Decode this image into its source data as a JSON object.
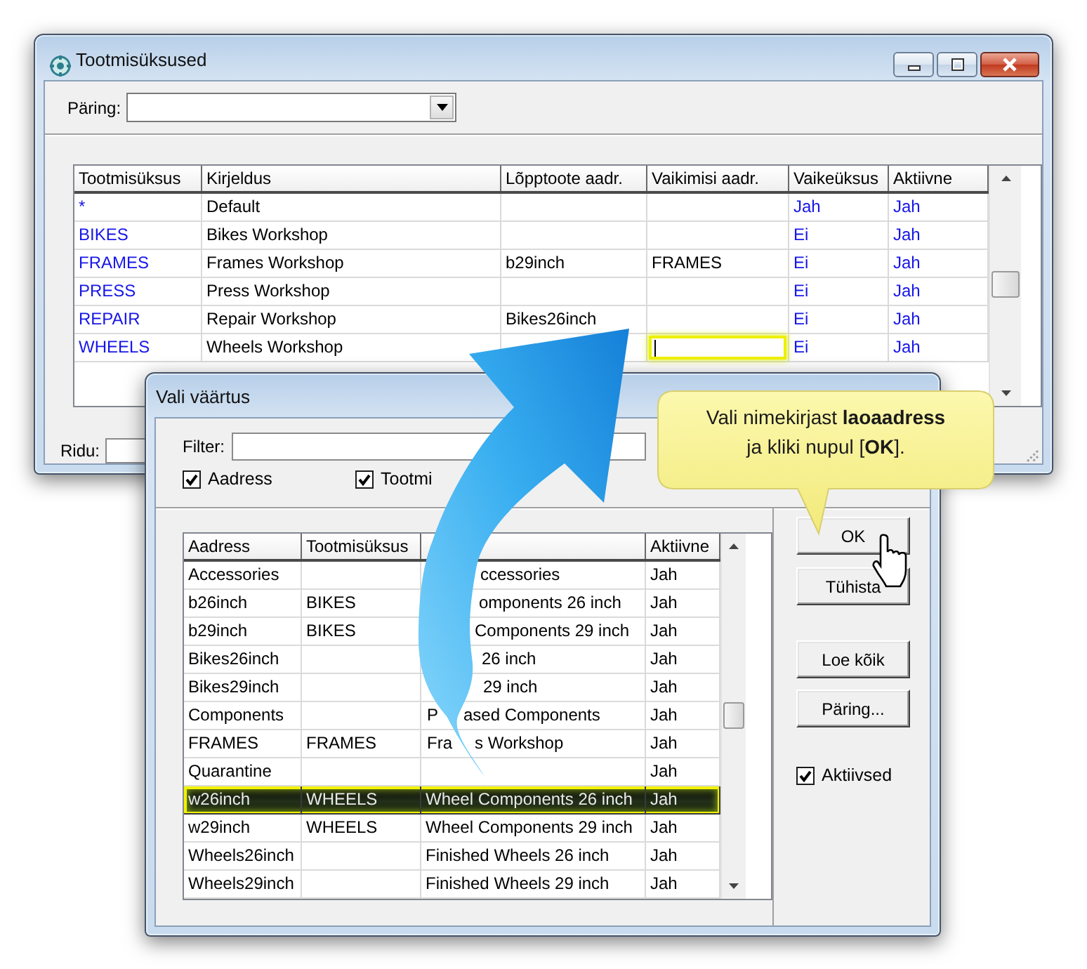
{
  "main_window": {
    "title": "Tootmisüksused",
    "query": {
      "label": "Päring:"
    },
    "table": {
      "columns": [
        "Tootmisüksus",
        "Kirjeldus",
        "Lõpptoote aadr.",
        "Vaikimisi aadr.",
        "Vaikeüksus",
        "Aktiivne"
      ],
      "rows": [
        {
          "unit": "*",
          "description": "Default",
          "default_unit": "Jah",
          "active": "Jah",
          "editing": false
        },
        {
          "unit": "BIKES",
          "description": "Bikes Workshop",
          "default_unit": "Ei",
          "active": "Jah",
          "editing": false
        },
        {
          "unit": "FRAMES",
          "description": "Frames Workshop",
          "product_address": "b29inch",
          "default_address": "FRAMES",
          "default_unit": "Ei",
          "active": "Jah",
          "editing": false
        },
        {
          "unit": "PRESS",
          "description": "Press Workshop",
          "default_unit": "Ei",
          "active": "Jah",
          "editing": false
        },
        {
          "unit": "REPAIR",
          "description": "Repair Workshop",
          "product_address": "Bikes26inch",
          "default_unit": "Ei",
          "active": "Jah",
          "editing": false
        },
        {
          "unit": "WHEELS",
          "description": "Wheels Workshop",
          "default_unit": "Ei",
          "active": "Jah",
          "editing": true
        }
      ]
    },
    "status": {
      "label": "Ridu:"
    }
  },
  "dialog": {
    "title": "Vali väärtus",
    "filter": {
      "label": "Filter:"
    },
    "checkboxes": [
      {
        "label": "Aadress",
        "checked": true
      },
      {
        "label": "Tootmi",
        "checked": true
      }
    ],
    "table": {
      "columns": {
        "address": "Aadress",
        "unit": "Tootmisüksus",
        "active": "Aktiivne"
      },
      "rows": [
        {
          "address": "Accessories",
          "column_3": {
            "right_part": "ccessories"
          },
          "active": "Jah",
          "selected": false
        },
        {
          "address": "b26inch",
          "unit": "BIKES",
          "column_3": {
            "right_part": "omponents 26 inch"
          },
          "active": "Jah",
          "selected": false
        },
        {
          "address": "b29inch",
          "unit": "BIKES",
          "column_3": {
            "right_part": "Components 29 inch"
          },
          "active": "Jah",
          "selected": false
        },
        {
          "address": "Bikes26inch",
          "column_3": {
            "right_part": "26 inch"
          },
          "active": "Jah",
          "selected": false
        },
        {
          "address": "Bikes29inch",
          "column_3": {
            "right_part": "29 inch"
          },
          "active": "Jah",
          "selected": false
        },
        {
          "address": "Components",
          "column_3": {
            "left_part": "P",
            "right_part": "ased Components"
          },
          "active": "Jah",
          "selected": false
        },
        {
          "address": "FRAMES",
          "unit": "FRAMES",
          "column_3": {
            "left_part": "Fra",
            "right_part": "s Workshop"
          },
          "active": "Jah",
          "selected": false
        },
        {
          "address": "Quarantine",
          "active": "Jah",
          "selected": false
        },
        {
          "address": "w26inch",
          "unit": "WHEELS",
          "column_3": {
            "text": "Wheel Components 26 inch"
          },
          "active": "Jah",
          "selected": true
        },
        {
          "address": "w29inch",
          "unit": "WHEELS",
          "column_3": {
            "text": "Wheel Components 29 inch"
          },
          "active": "Jah",
          "selected": false
        },
        {
          "address": "Wheels26inch",
          "column_3": {
            "text": "Finished Wheels 26 inch"
          },
          "active": "Jah",
          "selected": false
        },
        {
          "address": "Wheels29inch",
          "column_3": {
            "text": "Finished Wheels 29 inch"
          },
          "active": "Jah",
          "selected": false
        }
      ]
    },
    "action_buttons": [
      {
        "label": "OK"
      },
      {
        "label": "Tühista"
      }
    ],
    "list_buttons": [
      {
        "label": "Loe kõik"
      },
      {
        "label": "Päring..."
      }
    ],
    "active_only": {
      "label": "Aktiivsed",
      "checked": true
    }
  },
  "callout": {
    "lines": [
      "Vali nimekirjast **laoaadress**",
      "ja kliki nupul [**OK**]."
    ]
  }
}
